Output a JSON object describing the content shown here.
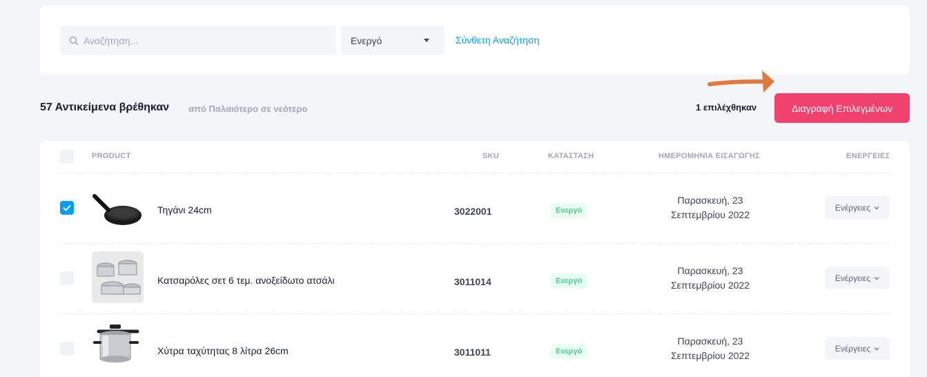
{
  "filters": {
    "search_placeholder": "Αναζήτηση...",
    "status_value": "Ενεργό",
    "advanced_search_label": "Σύνθετη Αναζήτηση"
  },
  "results": {
    "count_title": "57 Αντικείμενα βρέθηκαν",
    "sort_label": "από Παλαιότερο σε νεότερο",
    "selected_count": "1  επιλέχθηκαν",
    "delete_selected_label": "Διαγραφή Επιλεγμένων"
  },
  "table": {
    "headers": {
      "product": "PRODUCT",
      "sku": "SKU",
      "status": "ΚΑΤΑΣΤΑΣΗ",
      "date": "ΗΜΕΡΟΜΗΝΙΑ ΕΙΣΑΓΩΓΗΣ",
      "actions": "ΕΝΕΡΓΕΙΕΣ"
    },
    "rows": [
      {
        "name": "Τηγάνι 24cm",
        "sku": "3022001",
        "status": "Ενεργό",
        "date_line1": "Παρασκευή, 23",
        "date_line2": "Σεπτεμβρίου 2022",
        "actions_label": "Ενέργειες",
        "checked": true,
        "thumb_icon": "frying-pan-icon"
      },
      {
        "name": "Κατσαρόλες σετ 6 τεμ. ανοξείδωτο ατσάλι",
        "sku": "3011014",
        "status": "Ενεργό",
        "date_line1": "Παρασκευή, 23",
        "date_line2": "Σεπτεμβρίου 2022",
        "actions_label": "Ενέργειες",
        "checked": false,
        "thumb_icon": "cookware-set-icon"
      },
      {
        "name": "Χύτρα ταχύτητας 8 λίτρα 26cm",
        "sku": "3011011",
        "status": "Ενεργό",
        "date_line1": "Παρασκευή, 23",
        "date_line2": "Σεπτεμβρίου 2022",
        "actions_label": "Ενέργειες",
        "checked": false,
        "thumb_icon": "pressure-cooker-icon"
      }
    ]
  },
  "colors": {
    "accent": "#009ef7",
    "danger": "#f1416c",
    "success": "#50cd89",
    "annotation_arrow": "#e07a3c"
  }
}
